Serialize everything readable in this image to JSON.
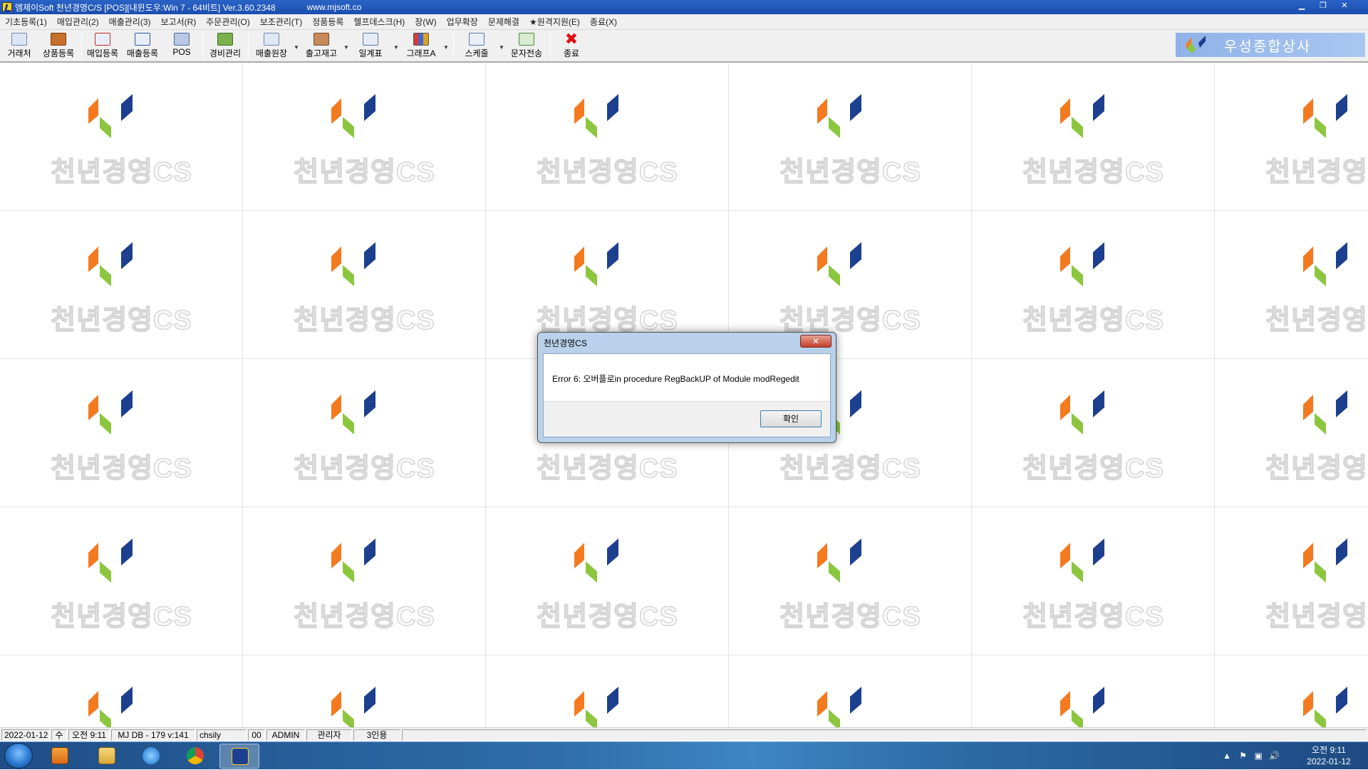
{
  "window": {
    "title": "엠제이Soft 천년경영C/S [POS][내윈도우:Win 7 - 64비트] Ver.3.60.2348",
    "url": "www.mjsoft.co"
  },
  "menu": [
    "기초등록(1)",
    "매입관리(2)",
    "매출관리(3)",
    "보고서(R)",
    "주문관리(O)",
    "보조관리(T)",
    "정품등록",
    "헬프데스크(H)",
    "창(W)",
    "업무확장",
    "문제해결",
    "★원격지원(E)",
    "종료(X)"
  ],
  "toolbar": {
    "b1": "거래처",
    "b2": "상품등록",
    "b3": "매입등록",
    "b4": "매출등록",
    "b5": "POS",
    "b6": "경비관리",
    "b7": "매출원장",
    "b8": "출고재고",
    "b9": "일계표",
    "b10": "그래프A",
    "b11": "스케줄",
    "b12": "문자전송",
    "b13": "종료"
  },
  "brand": "우성종합상사",
  "watermark": "천년경영CS",
  "dialog": {
    "title": "천년경영CS",
    "message": "Error 6: 오버플로in procedure RegBackUP of Module modRegedit",
    "ok": "확인",
    "close": "✕"
  },
  "status": {
    "date": "2022-01-12",
    "weekday": "수",
    "time": "오전 9:11",
    "db": "MJ DB - 179 v:141",
    "user": "chsily",
    "code": "00",
    "role": "ADMIN",
    "role_ko": "관리자",
    "license": "3인용"
  },
  "clock": {
    "time": "오전 9:11",
    "date": "2022-01-12"
  },
  "colors": {
    "logo_orange": "#f47a20",
    "logo_green": "#8cc63f",
    "logo_navy": "#1d3f8f",
    "titlebar": "#1b4fae"
  }
}
